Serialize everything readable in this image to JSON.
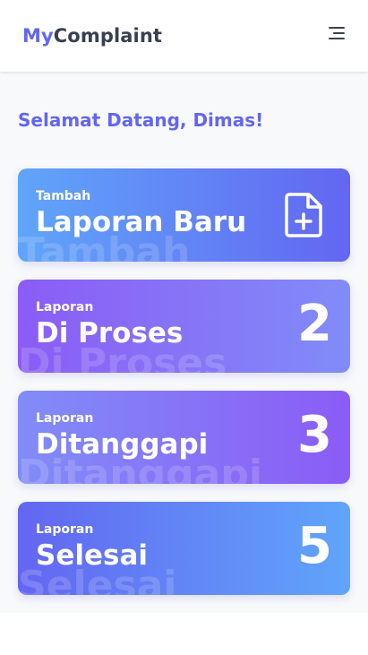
{
  "navbar": {
    "brand_part1": "My",
    "brand_part2": "Complaint",
    "menu_icon": "hamburger-menu-icon"
  },
  "welcome": "Selamat Datang, Dimas!",
  "cards": [
    {
      "small": "Tambah",
      "big": "Laporan Baru",
      "ghost": "Tambah",
      "icon": "file-plus-icon"
    },
    {
      "small": "Laporan",
      "big": "Di Proses",
      "ghost": "Di Proses",
      "count": "2"
    },
    {
      "small": "Laporan",
      "big": "Ditanggapi",
      "ghost": "Ditanggapi",
      "count": "3"
    },
    {
      "small": "Laporan",
      "big": "Selesai",
      "ghost": "Selesai",
      "count": "5"
    }
  ],
  "colors": {
    "brand_accent": "#6366f1",
    "brand_dark": "#374151",
    "blue": "#60a5fa",
    "indigo": "#6366f1",
    "violet": "#8b5cf6",
    "background": "#f8f9fb"
  }
}
